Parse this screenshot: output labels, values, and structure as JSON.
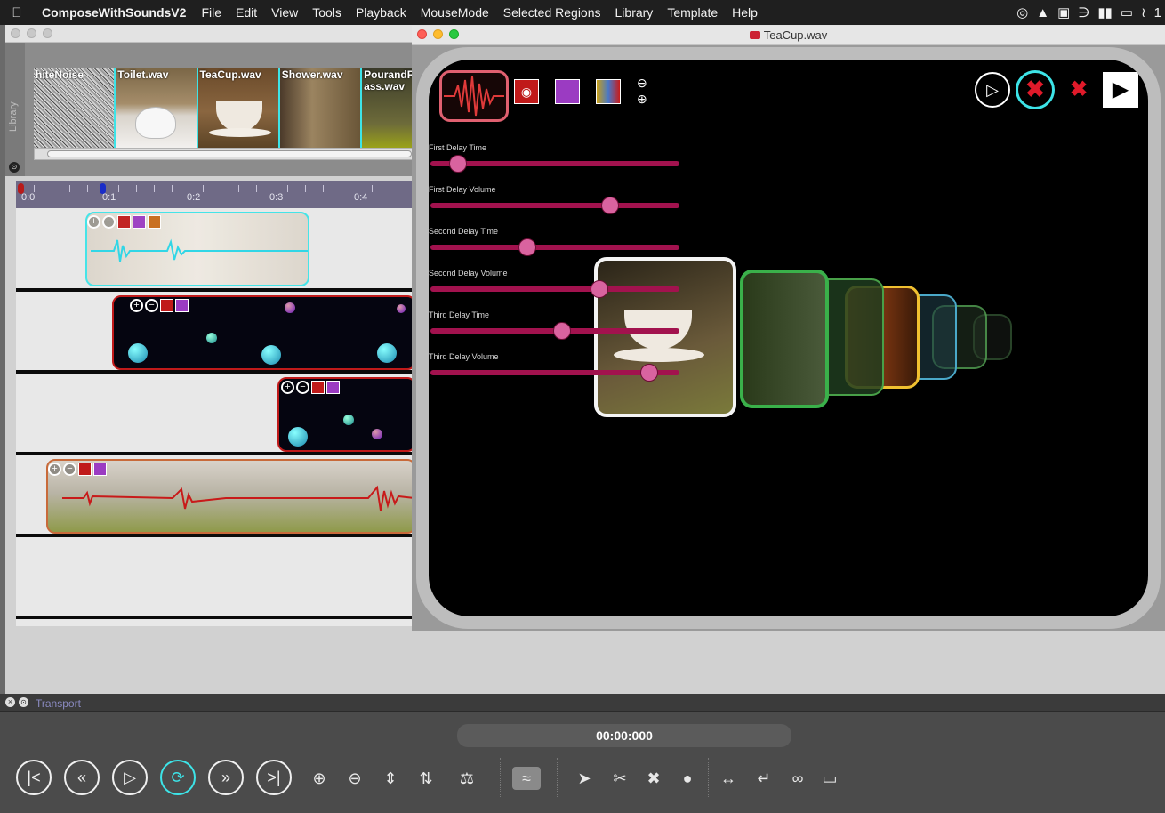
{
  "menubar": {
    "app_name": "ComposeWithSoundsV2",
    "items": [
      "File",
      "Edit",
      "View",
      "Tools",
      "Playback",
      "MouseMode",
      "Selected Regions",
      "Library",
      "Template",
      "Help"
    ],
    "status_trailing": "1"
  },
  "library": {
    "tab_label": "Library",
    "thumbnails": [
      {
        "name": "hiteNoise"
      },
      {
        "name": "Toilet.wav"
      },
      {
        "name": "TeaCup.wav"
      },
      {
        "name": "Shower.wav"
      },
      {
        "name": "PourandRi ass.wav"
      }
    ]
  },
  "ruler": {
    "ticks": [
      "0:0",
      "0:1",
      "0:2",
      "0:3",
      "0:4"
    ]
  },
  "fx_window": {
    "title": "TeaCup.wav",
    "sliders": [
      {
        "label": "First Delay Time",
        "value": 0.11
      },
      {
        "label": "First Delay Volume",
        "value": 0.72
      },
      {
        "label": "Second Delay Time",
        "value": 0.39
      },
      {
        "label": "Second Delay Volume",
        "value": 0.68
      },
      {
        "label": "Third Delay Time",
        "value": 0.53
      },
      {
        "label": "Third Delay Volume",
        "value": 0.88
      }
    ],
    "zoom_minus": "⊖",
    "zoom_plus": "⊕"
  },
  "transport": {
    "title": "Transport",
    "time": "00:00:000"
  },
  "colors": {
    "accent_cyan": "#3de4e8",
    "slider_track": "#a2124e",
    "slider_thumb": "#d9639f"
  },
  "icons": {
    "rewind_start": "skip-back-icon",
    "rewind": "rewind-icon",
    "play": "play-icon",
    "loop": "loop-icon",
    "fast_forward": "fast-forward-icon",
    "skip_end": "skip-forward-icon"
  }
}
